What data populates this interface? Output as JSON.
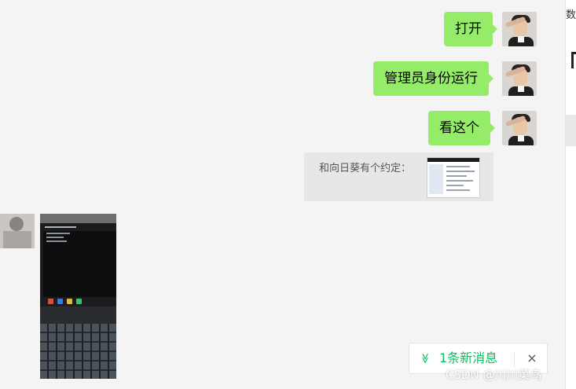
{
  "messages": [
    {
      "text": "打开"
    },
    {
      "text": "管理员身份运行"
    },
    {
      "text": "看这个"
    }
  ],
  "app_share": {
    "text": "和向日葵有个约定："
  },
  "new_message_bar": {
    "icon": "double-chevron-down-icon",
    "icon_glyph": "≫",
    "label": "1条新消息",
    "close": "×"
  },
  "side_panel": {
    "fragment": "数据"
  },
  "watermark": "CSDN @川川菜鸟",
  "colors": {
    "bubble": "#95ec69",
    "accent": "#07c160",
    "background": "#f4f4f4"
  }
}
